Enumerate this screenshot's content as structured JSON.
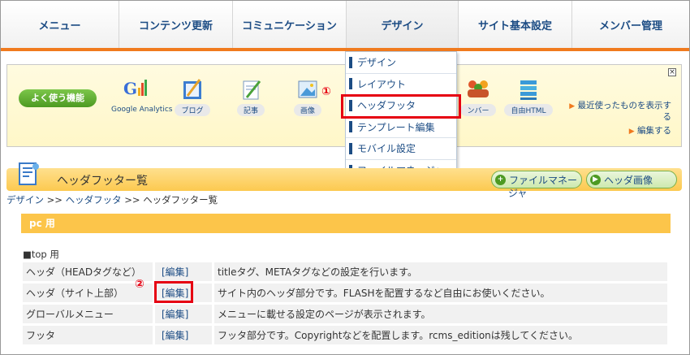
{
  "nav": [
    "メニュー",
    "コンテンツ更新",
    "コミュニケーション",
    "デザイン",
    "サイト基本設定",
    "メンバー管理"
  ],
  "favorites": {
    "label": "よく使う機能",
    "items": [
      {
        "name": "google-analytics",
        "label": "Google Analytics"
      },
      {
        "name": "blog",
        "label": "ブログ"
      },
      {
        "name": "article",
        "label": "記事"
      },
      {
        "name": "image",
        "label": "画像"
      },
      {
        "name": "member",
        "label": "ンバー"
      },
      {
        "name": "free-html",
        "label": "自由HTML"
      }
    ],
    "close": "×",
    "recent_link": "最近使ったものを表示する",
    "edit_link": "編集する"
  },
  "dropdown": [
    "デザイン",
    "レイアウト",
    "ヘッダフッタ",
    "テンプレート編集",
    "モバイル設定",
    "ファイルマネージャ"
  ],
  "markers": {
    "one": "①",
    "two": "②"
  },
  "page_title": "ヘッダフッター覧",
  "buttons": {
    "file_manager": "ファイルマネー",
    "file_manager_tail": "ジャ",
    "header_image": "ヘッダ画像"
  },
  "breadcrumb": {
    "a": "デザイン",
    "sep1": ">>",
    "b": "ヘッダフッタ",
    "sep2": ">>",
    "c": "ヘッダフッター覧"
  },
  "section": "pc 用",
  "subhead": "■top 用",
  "table": [
    {
      "name": "ヘッダ（HEADタグなど）",
      "action": "[編集]",
      "desc": "titleタグ、METAタグなどの設定を行います。"
    },
    {
      "name": "ヘッダ（サイト上部）",
      "action": "[編集]",
      "desc": "サイト内のヘッダ部分です。FLASHを配置するなど自由にお使いください。"
    },
    {
      "name": "グローバルメニュー",
      "action": "[編集]",
      "desc": "メニューに載せる設定のページが表示されます。"
    },
    {
      "name": "フッタ",
      "action": "[編集]",
      "desc": "フッタ部分です。Copyrightなどを配置します。rcms_editionは残してください。"
    }
  ],
  "colors": {
    "accent": "#f07a1e",
    "link": "#1c4c84",
    "highlight": "#e60012",
    "section": "#fcc54a"
  }
}
